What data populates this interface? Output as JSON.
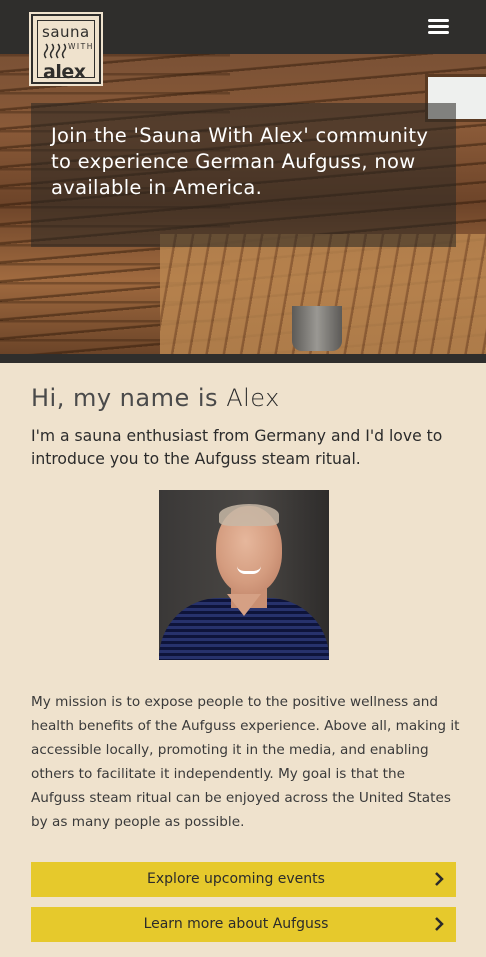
{
  "brand": {
    "logo_top": "sauna",
    "logo_with": "WITH",
    "logo_bottom": "alex"
  },
  "header": {
    "menu_icon": "hamburger-menu-icon",
    "background": "#2f2e2c"
  },
  "hero": {
    "headline": "Join the 'Sauna With Alex' community to experience German Aufguss, now available in America."
  },
  "about": {
    "greeting_prefix": "Hi, my name is",
    "greeting_name": "Alex",
    "intro": "I'm a sauna enthusiast from Germany and I'd love to introduce you to the Aufguss steam ritual.",
    "mission": "My mission is to expose people to the positive wellness and health benefits of the Aufguss experience. Above all, making it accessible locally, promoting it in the media, and enabling others to facilitate it independently. My goal is that the Aufguss steam ritual can be enjoyed across the United States by as many people as possible."
  },
  "buttons": [
    {
      "label": "Explore upcoming events",
      "icon": "chevron-right-icon"
    },
    {
      "label": "Learn more about Aufguss",
      "icon": "chevron-right-icon"
    }
  ],
  "colors": {
    "page_background": "#efe2cd",
    "accent_button": "#e6c92c",
    "dark": "#2f2e2c"
  }
}
